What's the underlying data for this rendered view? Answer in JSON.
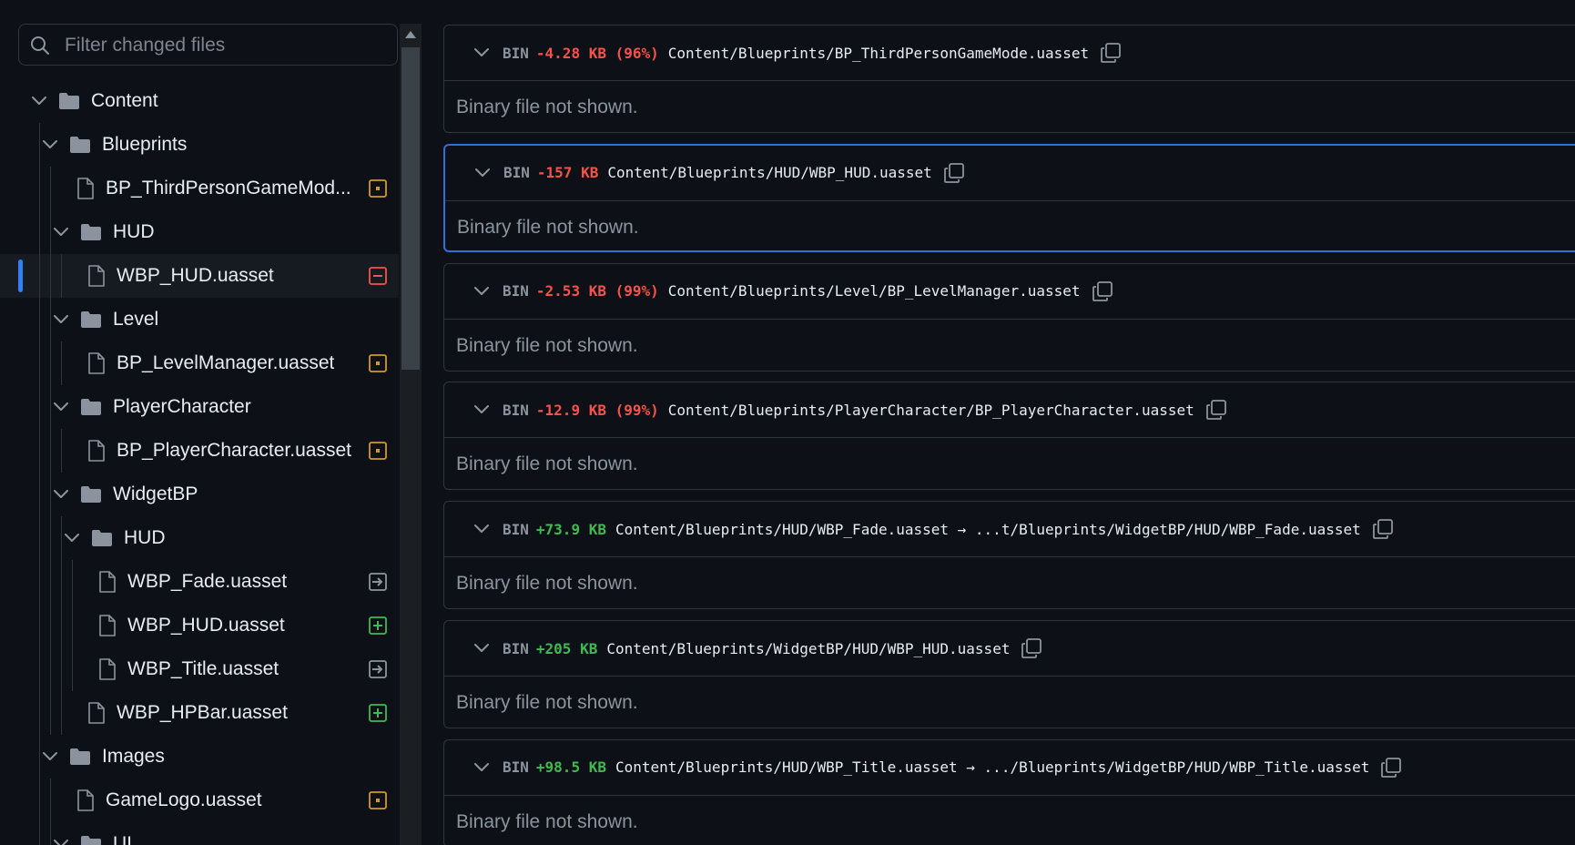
{
  "filter": {
    "placeholder": "Filter changed files"
  },
  "tree": [
    {
      "label": "Content",
      "kind": "folder",
      "depth": 0,
      "status": ""
    },
    {
      "label": "Blueprints",
      "kind": "folder",
      "depth": 1,
      "status": ""
    },
    {
      "label": "BP_ThirdPersonGameMod...",
      "kind": "file",
      "depth": 2,
      "status": "modified"
    },
    {
      "label": "HUD",
      "kind": "folder",
      "depth": 2,
      "status": ""
    },
    {
      "label": "WBP_HUD.uasset",
      "kind": "file",
      "depth": 3,
      "status": "deleted",
      "selected": true
    },
    {
      "label": "Level",
      "kind": "folder",
      "depth": 2,
      "status": ""
    },
    {
      "label": "BP_LevelManager.uasset",
      "kind": "file",
      "depth": 3,
      "status": "modified"
    },
    {
      "label": "PlayerCharacter",
      "kind": "folder",
      "depth": 2,
      "status": ""
    },
    {
      "label": "BP_PlayerCharacter.uasset",
      "kind": "file",
      "depth": 3,
      "status": "modified"
    },
    {
      "label": "WidgetBP",
      "kind": "folder",
      "depth": 2,
      "status": ""
    },
    {
      "label": "HUD",
      "kind": "folder",
      "depth": 3,
      "status": ""
    },
    {
      "label": "WBP_Fade.uasset",
      "kind": "file",
      "depth": 4,
      "status": "renamed"
    },
    {
      "label": "WBP_HUD.uasset",
      "kind": "file",
      "depth": 4,
      "status": "added"
    },
    {
      "label": "WBP_Title.uasset",
      "kind": "file",
      "depth": 4,
      "status": "renamed"
    },
    {
      "label": "WBP_HPBar.uasset",
      "kind": "file",
      "depth": 3,
      "status": "added"
    },
    {
      "label": "Images",
      "kind": "folder",
      "depth": 1,
      "status": ""
    },
    {
      "label": "GameLogo.uasset",
      "kind": "file",
      "depth": 2,
      "status": "modified"
    },
    {
      "label": "UI",
      "kind": "folder",
      "depth": 2,
      "status": ""
    }
  ],
  "diffs": [
    {
      "bin": "BIN",
      "delta": "-4.28 KB (96%)",
      "sign": "neg",
      "path": "Content/Blueprints/BP_ThirdPersonGameMode.uasset",
      "body": "Binary file not shown."
    },
    {
      "bin": "BIN",
      "delta": "-157 KB",
      "sign": "neg",
      "path": "Content/Blueprints/HUD/WBP_HUD.uasset",
      "body": "Binary file not shown.",
      "focused": true
    },
    {
      "bin": "BIN",
      "delta": "-2.53 KB (99%)",
      "sign": "neg",
      "path": "Content/Blueprints/Level/BP_LevelManager.uasset",
      "body": "Binary file not shown."
    },
    {
      "bin": "BIN",
      "delta": "-12.9 KB (99%)",
      "sign": "neg",
      "path": "Content/Blueprints/PlayerCharacter/BP_PlayerCharacter.uasset",
      "body": "Binary file not shown."
    },
    {
      "bin": "BIN",
      "delta": "+73.9 KB",
      "sign": "pos",
      "path": "Content/Blueprints/HUD/WBP_Fade.uasset → ...t/Blueprints/WidgetBP/HUD/WBP_Fade.uasset",
      "body": "Binary file not shown."
    },
    {
      "bin": "BIN",
      "delta": "+205 KB",
      "sign": "pos",
      "path": "Content/Blueprints/WidgetBP/HUD/WBP_HUD.uasset",
      "body": "Binary file not shown."
    },
    {
      "bin": "BIN",
      "delta": "+98.5 KB",
      "sign": "pos",
      "path": "Content/Blueprints/HUD/WBP_Title.uasset → .../Blueprints/WidgetBP/HUD/WBP_Title.uasset",
      "body": "Binary file not shown."
    }
  ],
  "colors": {
    "modified": "#d29922",
    "deleted": "#f85149",
    "added": "#3fb950",
    "renamed": "#8b949e",
    "accent": "#2f81f7",
    "background": "#0d1117",
    "border": "#30363d"
  }
}
